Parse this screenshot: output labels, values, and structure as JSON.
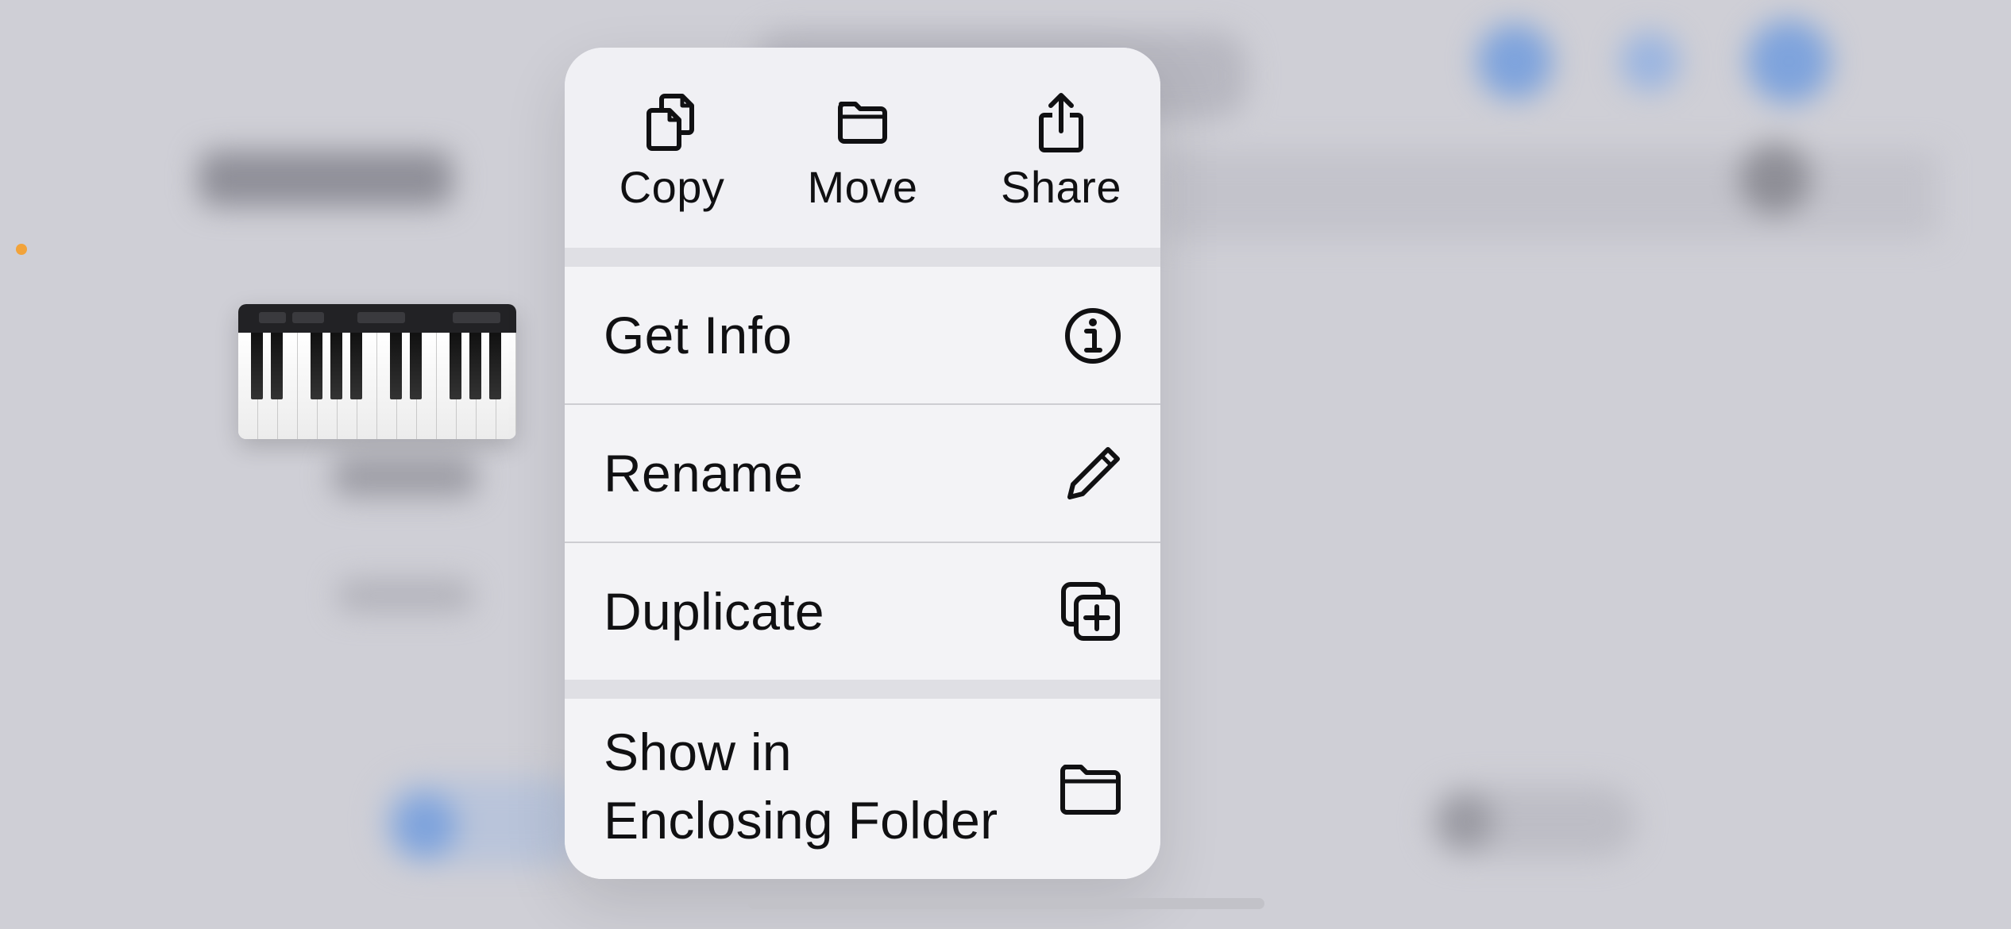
{
  "menu": {
    "actions": [
      {
        "label": "Copy",
        "icon": "copy-icon"
      },
      {
        "label": "Move",
        "icon": "folder-icon"
      },
      {
        "label": "Share",
        "icon": "share-icon"
      }
    ],
    "items": [
      {
        "label": "Get Info",
        "icon": "info-icon"
      },
      {
        "label": "Rename",
        "icon": "pencil-icon"
      },
      {
        "label": "Duplicate",
        "icon": "duplicate-icon"
      },
      {
        "label_line1": "Show in",
        "label_line2": "Enclosing Folder",
        "icon": "folder-icon"
      }
    ]
  },
  "preview": {
    "thumbnail": "piano-keyboard-thumbnail"
  },
  "colors": {
    "menu_background": "#f0f0f4",
    "text": "#101012",
    "indicator_dot": "#f2a33a",
    "background": "#cfcfd6"
  }
}
